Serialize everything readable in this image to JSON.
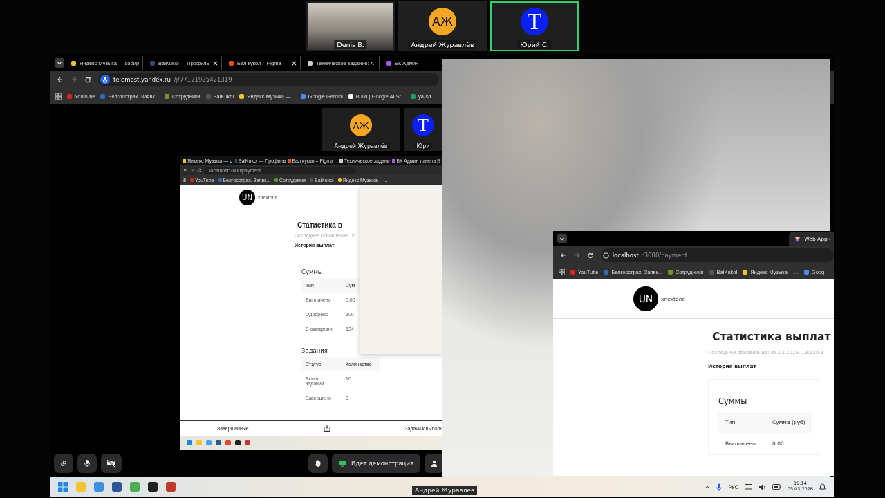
{
  "participants": [
    {
      "name": "Denis B.",
      "kind": "video",
      "speaking": false
    },
    {
      "name": "Андрей Журавлёв",
      "kind": "avatar",
      "initials": "АЖ",
      "color": "#f5a623",
      "speaking": false
    },
    {
      "name": "Юрий С.",
      "kind": "avatar",
      "initials": "T",
      "color": "#0a20f0",
      "speaking": true
    }
  ],
  "shared_browser": {
    "tabs": [
      {
        "title": "Яндекс Музыка — собир",
        "selected": false
      },
      {
        "title": "BalKukol — Профиль",
        "selected": false
      },
      {
        "title": "Бал кукол – Figma",
        "selected": false
      },
      {
        "title": "Техническое задание: А",
        "selected": false
      },
      {
        "title": "БК Админ",
        "selected": false
      }
    ],
    "address_host": "telemost.yandex.ru",
    "address_path": "/j/77121925421319",
    "bookmarks": [
      "YouTube",
      "Белгосстрах. Заявк...",
      "Сотрудники",
      "BalKukol",
      "Яндекс Музыка —...",
      "Google Gemini",
      "Build | Google AI St...",
      "ya-sd"
    ]
  },
  "nested_participants": [
    {
      "name": "Андрей Журавлёв",
      "initials": "АЖ",
      "color": "#f5a623"
    },
    {
      "name": "Юри",
      "initials": "T",
      "color": "#0a20f0"
    }
  ],
  "nested_screen": {
    "tabs": [
      "Яндекс Музыка — с",
      "BalKukol — Профиль",
      "Бал кукол – Figma",
      "Техническое задани",
      "БК Админ панель Б"
    ],
    "address": "localhost:3000/payment",
    "bookmarks": [
      "YouTube",
      "Белгосстрах. Заявк...",
      "Сотрудники",
      "BalKukol",
      "Яндекс Музыка —..."
    ],
    "avatar": "UN",
    "user": "xnextone",
    "title": "Статистика в",
    "subtitle": "Последнее обновление: 05",
    "link": "История выплат",
    "sums_title": "Суммы",
    "sums_columns": [
      "Тип",
      "Сум"
    ],
    "sums_rows": [
      [
        "Выплачено",
        "0.00"
      ],
      [
        "Одобрено",
        "100"
      ],
      [
        "В ожидании",
        "134"
      ]
    ],
    "tasks_title": "Задания",
    "tasks_columns": [
      "Статус",
      "Количество"
    ],
    "tasks_rows": [
      [
        "Всего заданий",
        "10"
      ],
      [
        "Завершено",
        "3"
      ]
    ],
    "bottom_left": "Завершенные",
    "bottom_right": "Задачи к выполн"
  },
  "payment_window": {
    "tab": "Web App (",
    "address_host": "localhost",
    "address_path": ":3000/payment",
    "bookmarks": [
      "YouTube",
      "Белгосстрах. Заявк...",
      "Сотрудники",
      "BalKukol",
      "Яндекс Музыка —...",
      "Goog"
    ],
    "avatar": "UN",
    "user": "xnextone",
    "title": "Статистика выплат",
    "subtitle": "Последнее обновление: 05.03.2026, 19:13:58",
    "link": "История выплат",
    "sums_title": "Суммы",
    "columns": [
      "Тип",
      "Сумма (руб)"
    ],
    "rows": [
      [
        "Выплачено",
        "0.00"
      ]
    ]
  },
  "call_controls": {
    "demo_button": "Идет демонстрация"
  },
  "taskbar": {
    "tooltip": "Андрей Журавлёв",
    "language": "РУС",
    "time": "19:14",
    "date": "05.03.2026"
  }
}
